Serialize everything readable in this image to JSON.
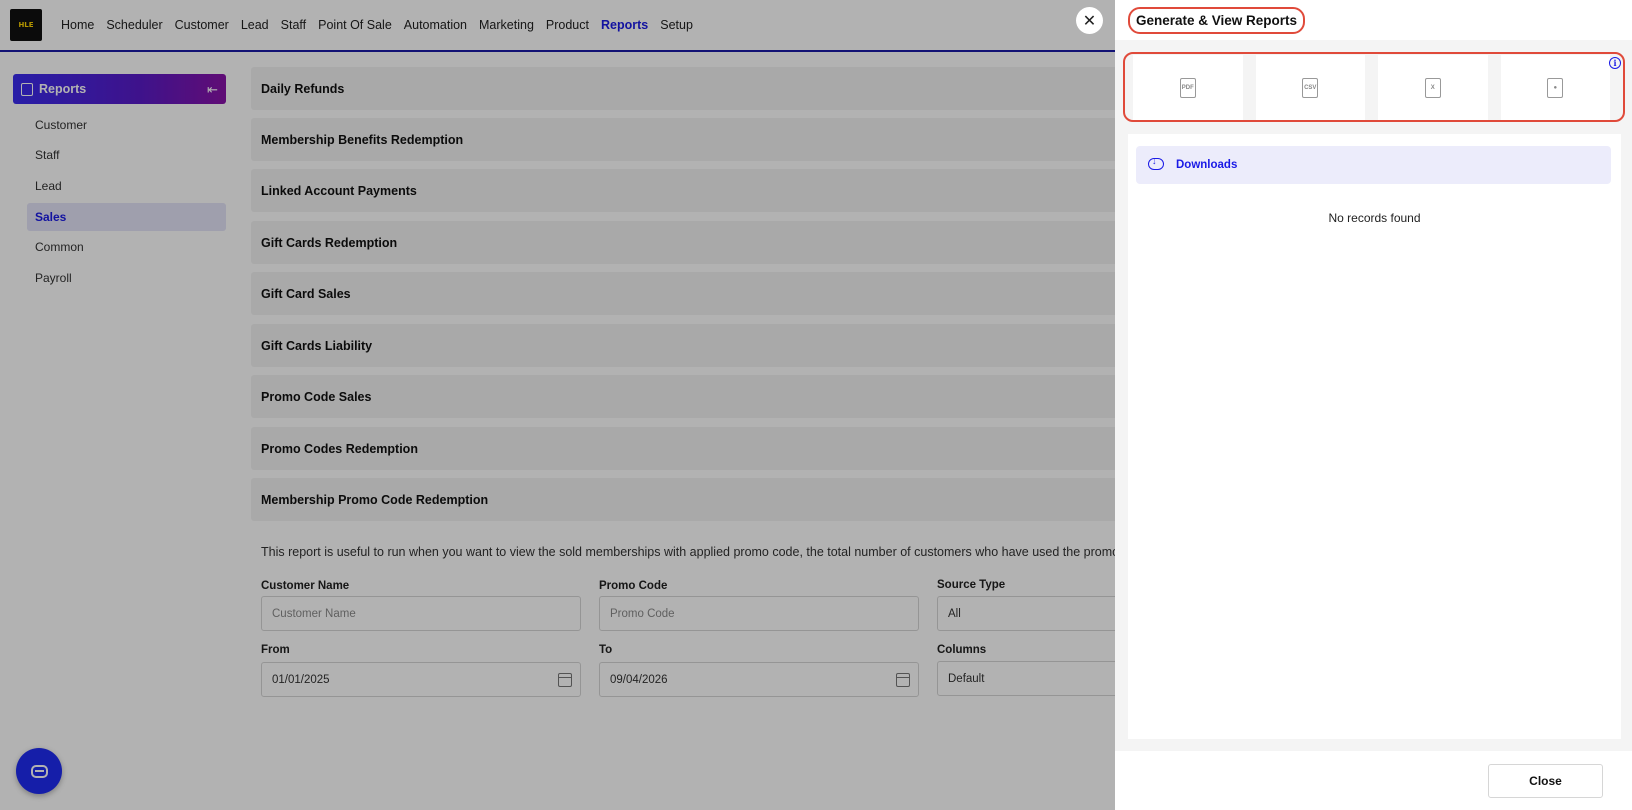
{
  "logo_text": "HLE",
  "nav": [
    "Home",
    "Scheduler",
    "Customer",
    "Lead",
    "Staff",
    "Point Of Sale",
    "Automation",
    "Marketing",
    "Product",
    "Reports",
    "Setup"
  ],
  "nav_active": "Reports",
  "sidebar": {
    "title": "Reports",
    "items": [
      "Customer",
      "Staff",
      "Lead",
      "Sales",
      "Common",
      "Payroll"
    ],
    "active": "Sales"
  },
  "reports": [
    "Daily Refunds",
    "Membership Benefits Redemption",
    "Linked Account Payments",
    "Gift Cards Redemption",
    "Gift Card Sales",
    "Gift Cards Liability",
    "Promo Code Sales",
    "Promo Codes Redemption",
    "Membership Promo Code Redemption"
  ],
  "description": "This report is useful to run when you want to view the sold memberships with applied promo code, the total number of customers who have used the promo a",
  "filters": {
    "customer_name_label": "Customer Name",
    "customer_name_placeholder": "Customer Name",
    "promo_code_label": "Promo Code",
    "promo_code_placeholder": "Promo Code",
    "source_type_label": "Source Type",
    "source_type_value": "All",
    "from_label": "From",
    "from_value": "01/01/2025",
    "to_label": "To",
    "to_value": "09/04/2026",
    "columns_label": "Columns",
    "columns_value": "Default"
  },
  "drawer": {
    "title": "Generate & View Reports",
    "export_icons": [
      "pdf-file-icon",
      "csv-file-icon",
      "excel-file-icon",
      "contact-card-icon"
    ],
    "export_labels": [
      "PDF",
      "CSV",
      "X"
    ],
    "downloads_label": "Downloads",
    "empty_text": "No records found",
    "close_label": "Close"
  },
  "colors": {
    "accent": "#1a1ae6",
    "highlight": "#e04a3a",
    "sidebar_gradient_start": "#3a2bf0",
    "sidebar_gradient_end": "#8a12a8"
  }
}
